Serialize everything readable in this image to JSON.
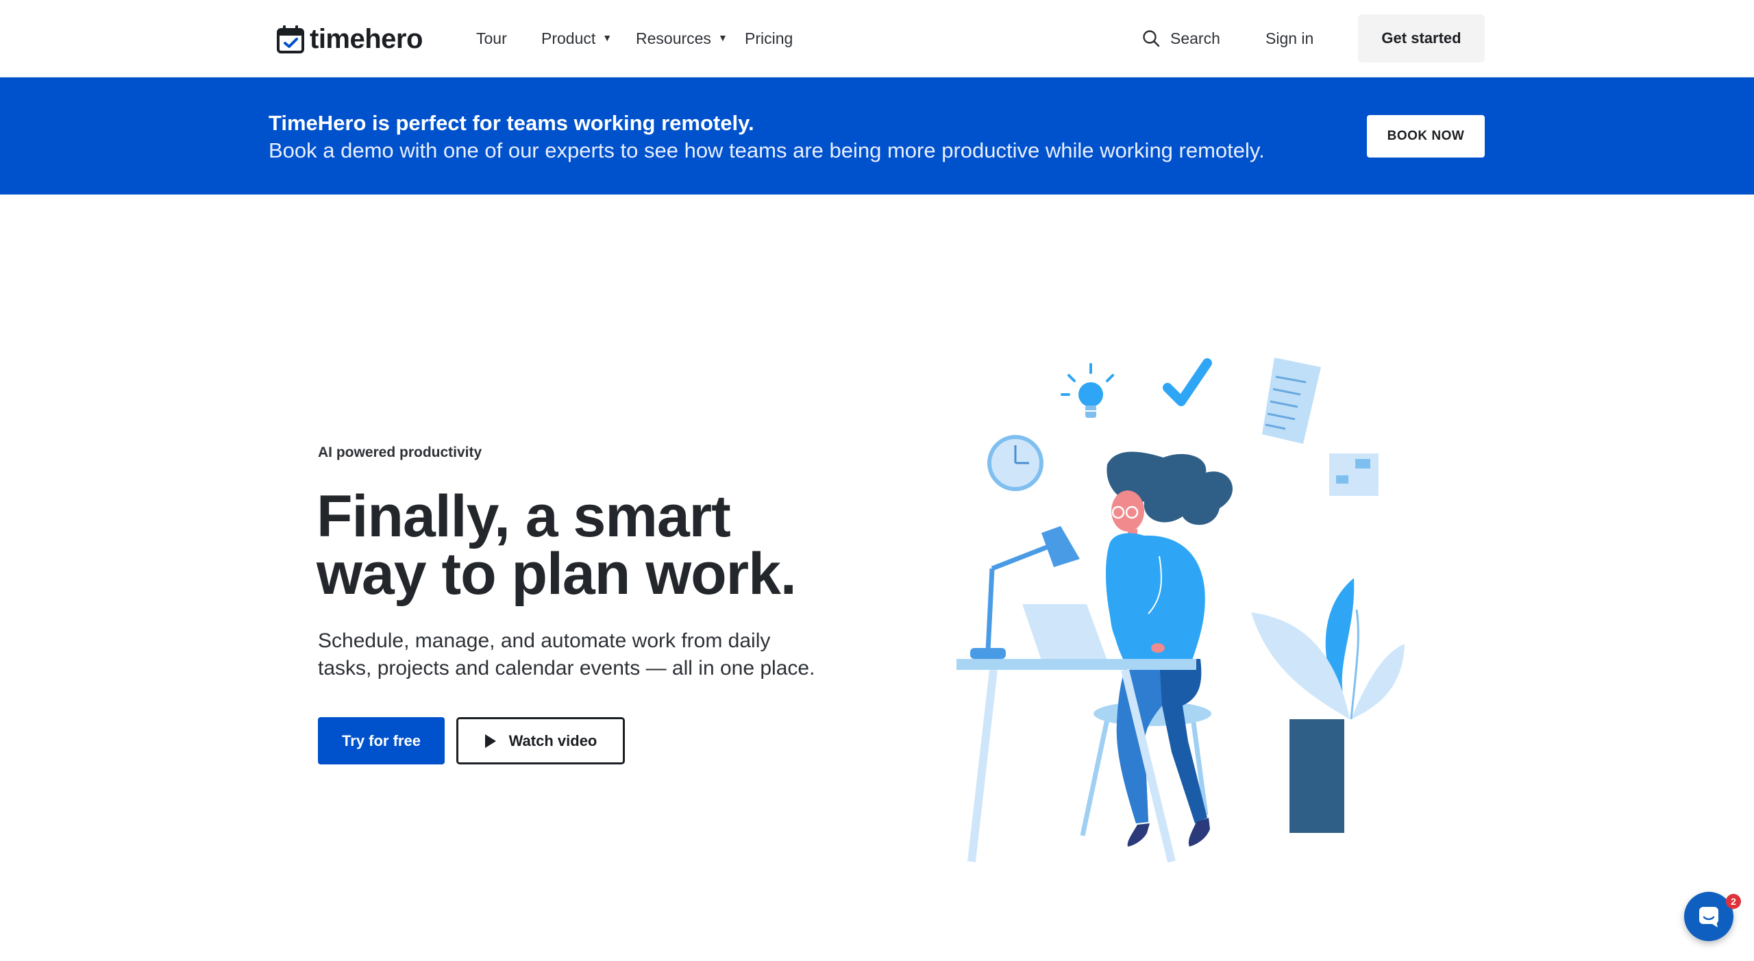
{
  "nav": {
    "logo_text": "timehero",
    "items": [
      {
        "label": "Tour"
      },
      {
        "label": "Product",
        "dropdown": true
      },
      {
        "label": "Resources",
        "dropdown": true
      },
      {
        "label": "Pricing"
      }
    ],
    "search_label": "Search",
    "signin_label": "Sign in",
    "cta_label": "Get started"
  },
  "banner": {
    "title": "TimeHero is perfect for teams working remotely.",
    "subtitle": "Book a demo with one of our experts to see how teams are being more productive while working remotely.",
    "button_label": "BOOK NOW",
    "background_color": "#0051cc"
  },
  "hero": {
    "eyebrow": "AI powered productivity",
    "headline_line1": "Finally, a smart",
    "headline_line2": "way to plan work.",
    "subtext_line1": "Schedule, manage, and automate work from daily",
    "subtext_line2": "tasks, projects and calendar events — all in one place.",
    "primary_button": "Try for free",
    "secondary_button": "Watch video",
    "illustration": "woman-working-at-desk-illustration"
  },
  "chat": {
    "icon": "chat-bubble-icon",
    "badge_count": "2"
  },
  "colors": {
    "brand_blue": "#0051cc",
    "text_dark": "#23272b",
    "illustration_blue": "#2ea6f5",
    "illustration_navy": "#2f5f86"
  }
}
